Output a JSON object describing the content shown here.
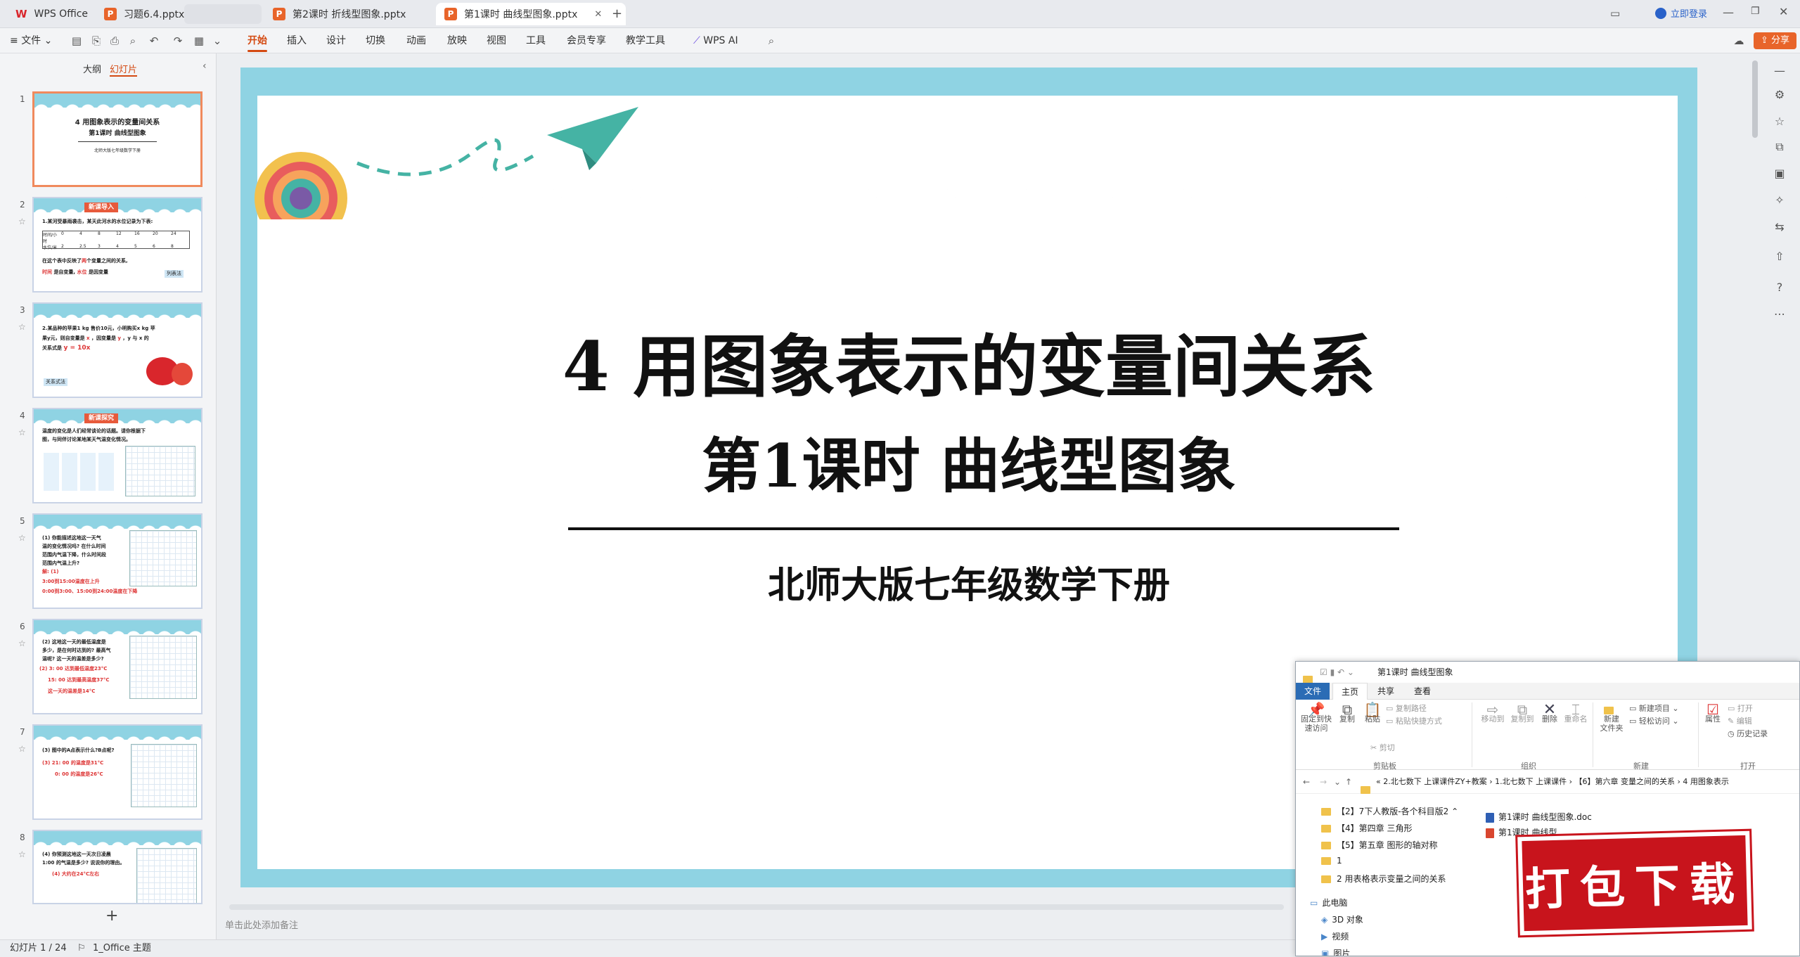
{
  "tabs": [
    {
      "label": "WPS Office"
    },
    {
      "label": "习题6.4.pptx"
    },
    {
      "label": "第2课时 折线型图象.pptx"
    },
    {
      "label": "第1课时 曲线型图象.pptx"
    }
  ],
  "titlebar": {
    "login": "立即登录"
  },
  "menubar": {
    "file": "文件",
    "items": [
      "开始",
      "插入",
      "设计",
      "切换",
      "动画",
      "放映",
      "视图",
      "工具",
      "会员专享",
      "教学工具"
    ],
    "wps_ai": "WPS AI",
    "share": "分享"
  },
  "leftpanel": {
    "tab_outline": "大纲",
    "tab_slides": "幻灯片",
    "add": "+"
  },
  "thumbs": {
    "s1": {
      "num": "1",
      "title": "4 用图象表示的变量间关系",
      "sub": "第1课时 曲线型图象",
      "small": "北师大版七年级数学下册"
    },
    "s2": {
      "num": "2",
      "badge": "新课导入",
      "line1": "1.某河受暴雨袭击，某天此河水的水位记录为下表:",
      "row1": [
        "时间/小时",
        "0",
        "4",
        "8",
        "12",
        "16",
        "20",
        "24"
      ],
      "row2": [
        "水位/米",
        "2",
        "2.5",
        "3",
        "4",
        "5",
        "6",
        "8"
      ],
      "line2": "在这个表中反映了",
      "red1": "两",
      "line2b": "个变量之间的关系,",
      "red2": "时间",
      "line3": "是自变量,",
      "red3": "水位",
      "line3b": "是因变量",
      "tag": "列表法"
    },
    "s3": {
      "num": "3",
      "line1": "2.某品种的苹果1 kg 售价10元，小明购买x kg 苹",
      "line2": "果y元，则自变量是",
      "red1": "x",
      "line2b": "，因变量是",
      "red2": "y",
      "line2c": "，y 与 x 的",
      "line3": "关系式是",
      "red3": "y = 10x",
      "tag": "关系式法"
    },
    "s4": {
      "num": "4",
      "badge": "新课探究",
      "line1": "温度的变化是人们经常谈论的话题。请你根据下",
      "line2": "图，与同伴讨论某地某天气温变化情况。"
    },
    "s5": {
      "num": "5",
      "line1": "(1) 你能描述这地这一天气",
      "line2": "温的变化情况吗? 在什么时间",
      "line3": "范围内气温下降，什么时间段",
      "line4": "范围内气温上升?",
      "red1": "解: (1)",
      "red2": "3:00到15:00温度在上升",
      "red3": "0:00到3:00、15:00到24:00温度在下降"
    },
    "s6": {
      "num": "6",
      "line1": "(2) 这地这一天的最低温度是",
      "line2": "多少，是在何时达到的? 最高气",
      "line3": "温呢? 这一天的温差是多少?",
      "red1": "(2) 3: 00 达到最低温度23°C",
      "red2": "15: 00 达到最高温度37°C",
      "red3": "这一天的温差是14°C"
    },
    "s7": {
      "num": "7",
      "line1": "(3) 图中的A点表示什么?B点呢?",
      "red1": "(3) 21: 00 的温度是31°C",
      "red2": "0: 00 的温度是26°C"
    },
    "s8": {
      "num": "8",
      "line1": "(4) 你预测这地这一天次日凌晨",
      "line2": "1:00 的气温是多少? 说说你的理由。",
      "red1": "(4) 大约在24°C左右"
    }
  },
  "slide": {
    "title": "4 用图象表示的变量间关系",
    "subtitle": "第1课时 曲线型图象",
    "caption": "北师大版七年级数学下册"
  },
  "notes_placeholder": "单击此处添加备注",
  "status": {
    "slide_count": "幻灯片 1 / 24",
    "theme": "1_Office 主题"
  },
  "explorer": {
    "title": "第1课时 曲线型图象",
    "tabs": [
      "文件",
      "主页",
      "共享",
      "查看"
    ],
    "ribbon": {
      "pin": "固定到快\n速访问",
      "copy": "复制",
      "paste": "粘贴",
      "copy_path": "复制路径",
      "paste_shortcut": "粘贴快捷方式",
      "cut": "剪切",
      "move_to": "移动到",
      "copy_to": "复制到",
      "delete": "删除",
      "rename": "重命名",
      "new_folder": "新建\n文件夹",
      "new_item": "新建项目",
      "easy_access": "轻松访问",
      "properties": "属性",
      "open": "打开",
      "edit": "编辑",
      "history": "历史记录",
      "g_clipboard": "剪贴板",
      "g_organize": "组织",
      "g_new": "新建",
      "g_open": "打开"
    },
    "breadcrumb": [
      "«  2.北七数下 上课课件ZY+教案",
      "1.北七数下 上课课件",
      "【6】第六章 变量之间的关系",
      "4 用图象表示"
    ],
    "left_items": [
      "【2】7下人教版-各个科目版2",
      "【4】第四章 三角形",
      "【5】第五章 图形的轴对称",
      "1",
      "2 用表格表示变量之间的关系"
    ],
    "nav_items": [
      "此电脑",
      "3D 对象",
      "视频",
      "图片"
    ],
    "files": [
      "第1课时 曲线型图象.doc",
      "第1课时 曲线型"
    ]
  },
  "download_banner": "打包下载",
  "colors": {
    "accent": "#d44a12",
    "slide_frame": "#8fd3e3",
    "banner": "#c8141c"
  }
}
